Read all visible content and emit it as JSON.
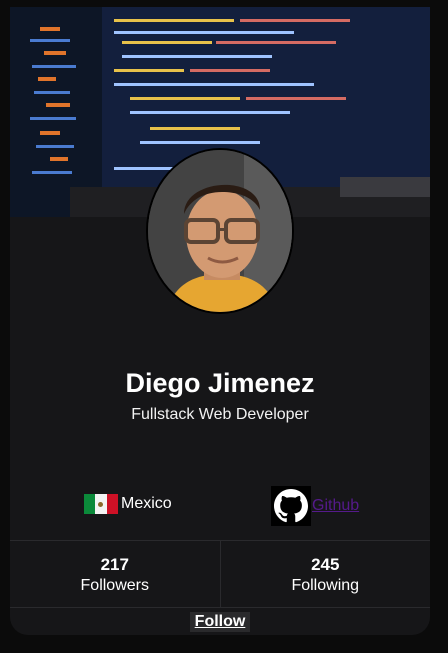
{
  "profile": {
    "name": "Diego Jimenez",
    "title": "Fullstack Web Developer",
    "location": "Mexico",
    "github_label": "Github"
  },
  "stats": [
    {
      "value": "217",
      "label": "Followers"
    },
    {
      "value": "245",
      "label": "Following"
    }
  ],
  "actions": {
    "follow_label": "Follow"
  },
  "icons": {
    "flag": "mexico-flag-icon",
    "github": "github-icon"
  },
  "colors": {
    "card_bg": "#161618",
    "link": "#551a8b",
    "flag_green": "#0b8a3a",
    "flag_red": "#ce1126"
  }
}
